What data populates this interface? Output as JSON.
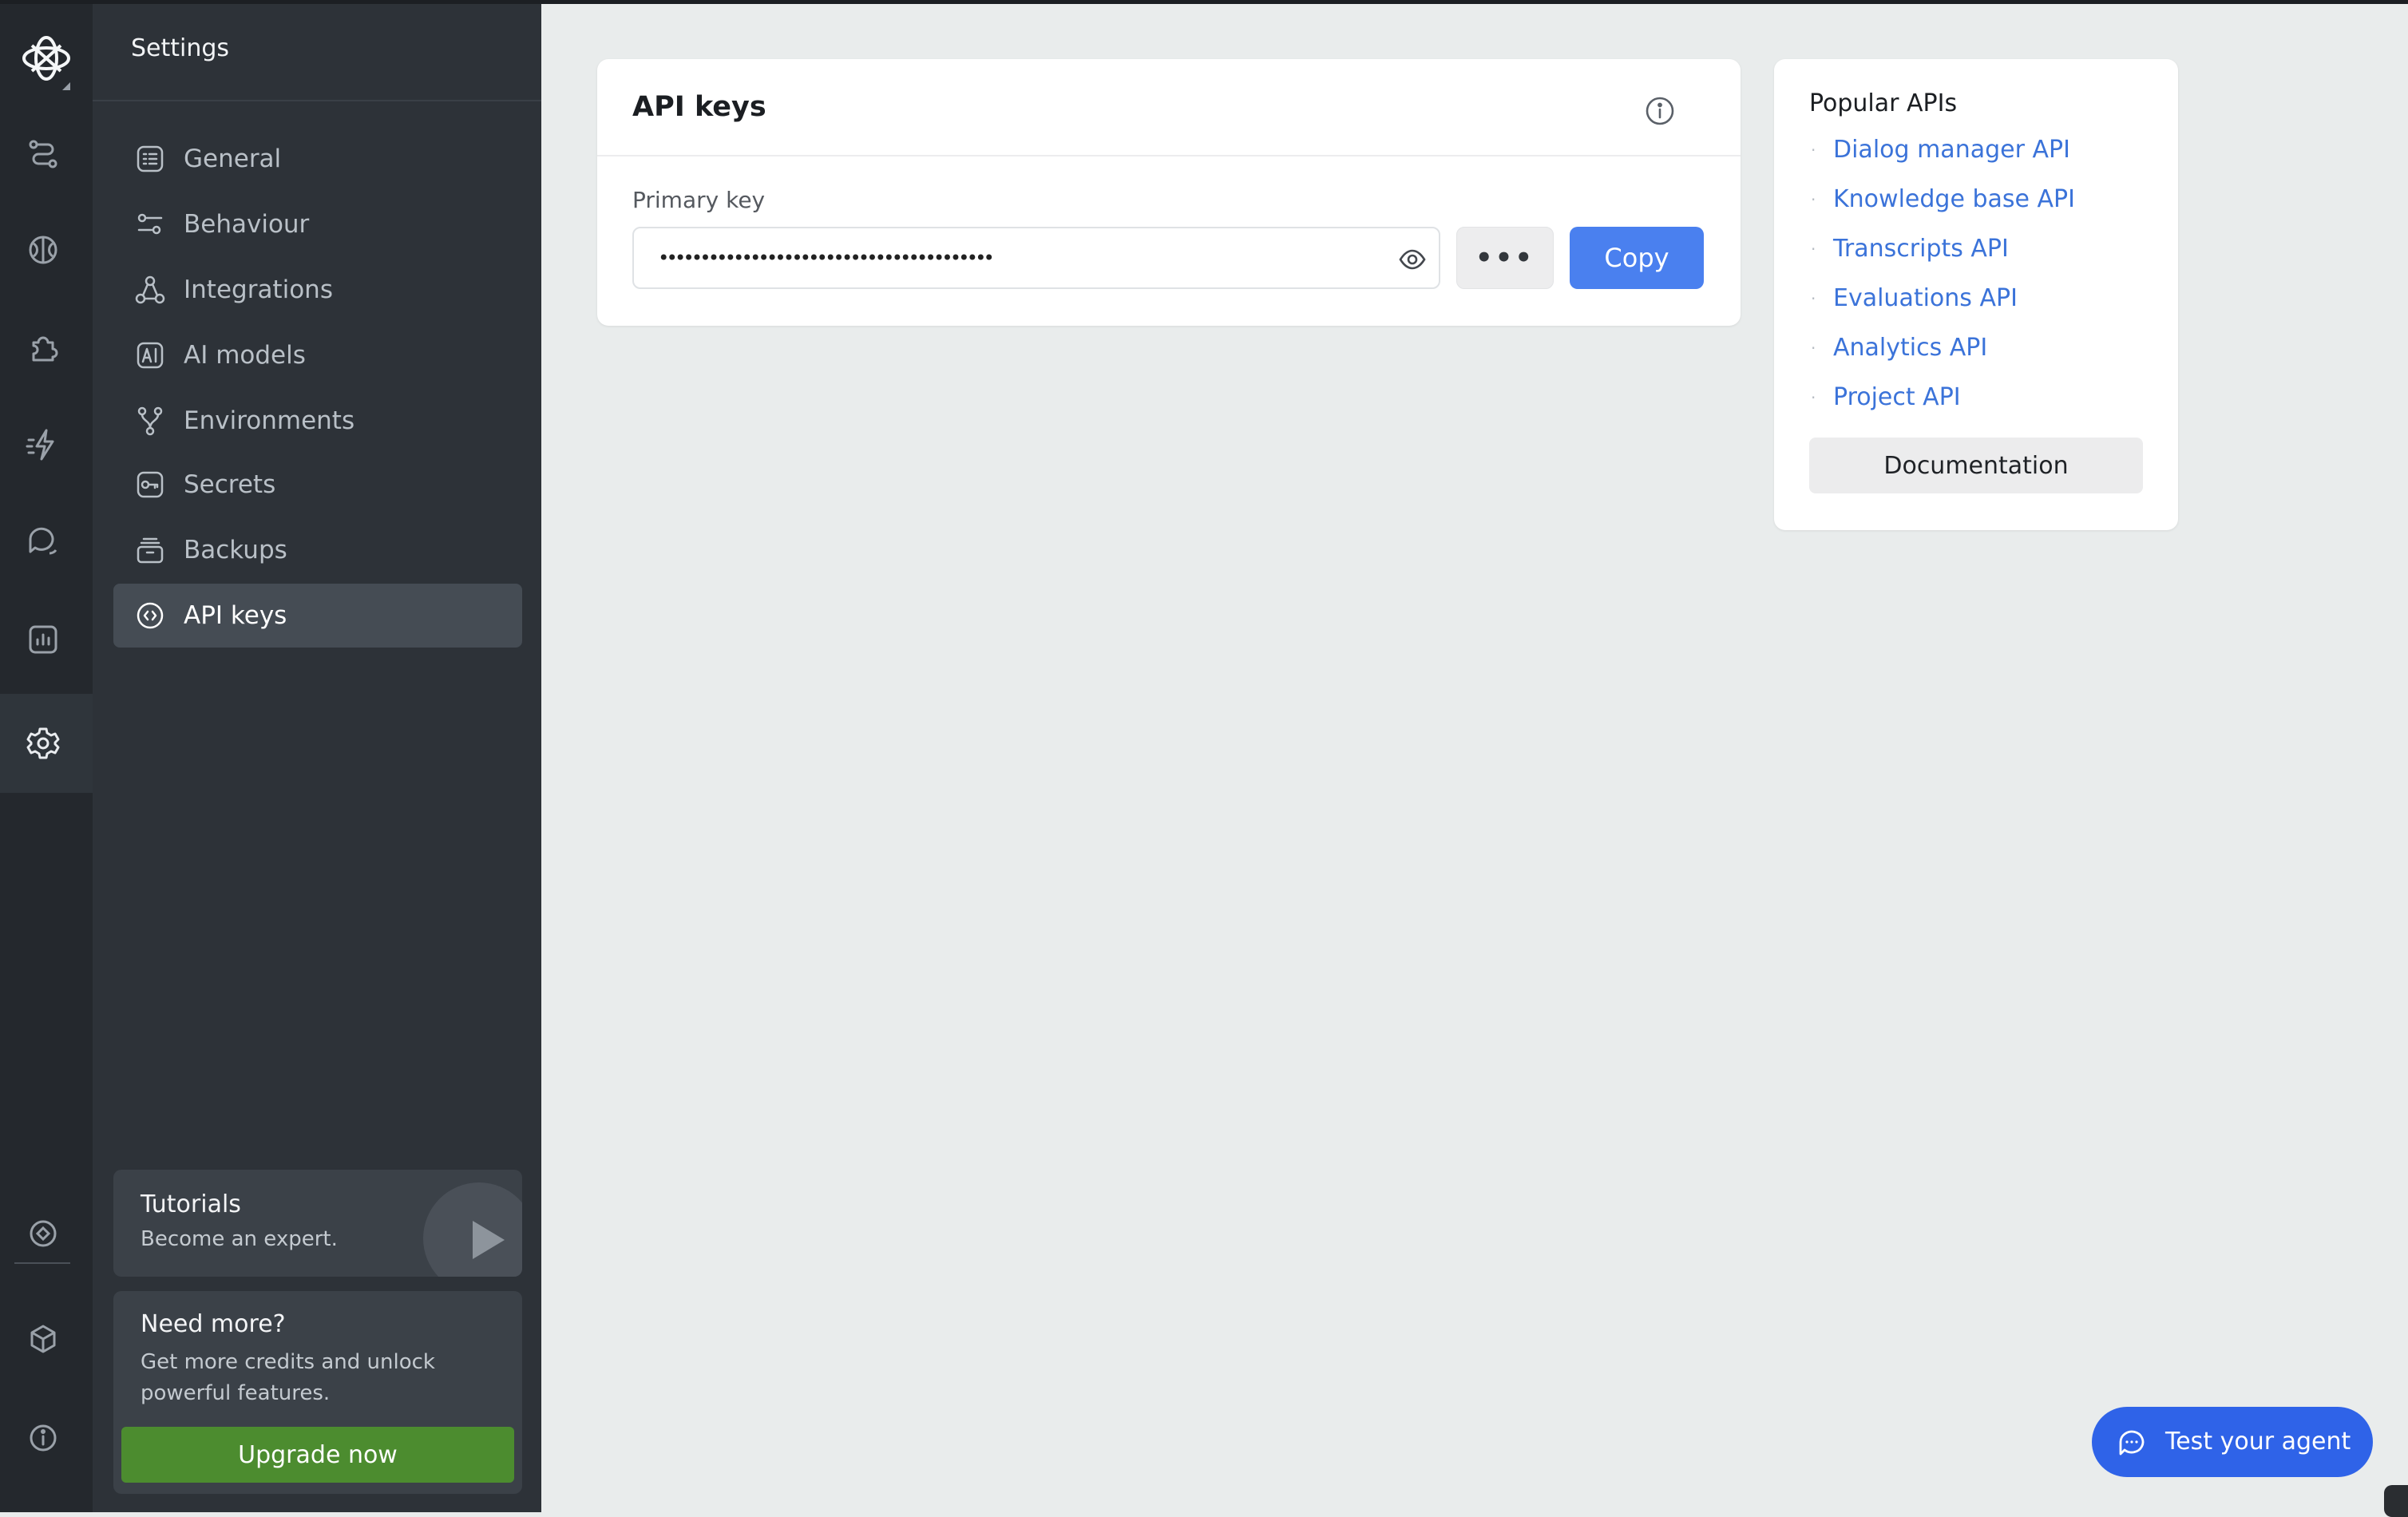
{
  "sidebar": {
    "title": "Settings",
    "items": [
      {
        "label": "General",
        "icon": "general-icon"
      },
      {
        "label": "Behaviour",
        "icon": "sliders-icon"
      },
      {
        "label": "Integrations",
        "icon": "integrations-icon"
      },
      {
        "label": "AI models",
        "icon": "ai-models-icon"
      },
      {
        "label": "Environments",
        "icon": "branch-icon"
      },
      {
        "label": "Secrets",
        "icon": "key-icon"
      },
      {
        "label": "Backups",
        "icon": "archive-icon"
      },
      {
        "label": "API keys",
        "icon": "api-icon",
        "active": true
      }
    ],
    "tutorials": {
      "title": "Tutorials",
      "subtitle": "Become an expert."
    },
    "need_more": {
      "title": "Need more?",
      "text": "Get more credits and unlock powerful features.",
      "button": "Upgrade now"
    }
  },
  "rail": {
    "icons": [
      "logo-icon",
      "flows-icon",
      "knowledge-icon",
      "integrations-puzzle-icon",
      "actions-icon",
      "chat-icon",
      "analytics-icon",
      "settings-icon",
      "target-icon",
      "cube-icon",
      "info-icon"
    ],
    "active": "settings-icon"
  },
  "main": {
    "title": "API keys",
    "primary_key_label": "Primary key",
    "primary_key_value": "••••••••••••••••••••••••••••••••••••••••",
    "more_label": "•••",
    "copy_label": "Copy"
  },
  "popular": {
    "title": "Popular APIs",
    "links": [
      "Dialog manager API",
      "Knowledge base API",
      "Transcripts API",
      "Evaluations API",
      "Analytics API",
      "Project API"
    ],
    "button": "Documentation"
  },
  "test_agent": {
    "label": "Test your agent"
  },
  "colors": {
    "accent": "#4a80ef",
    "link": "#3b73d9",
    "upgrade": "#4c8c2f",
    "agent_button": "#2f63e8",
    "sidebar": "#2d3238",
    "rail": "#24282d"
  }
}
